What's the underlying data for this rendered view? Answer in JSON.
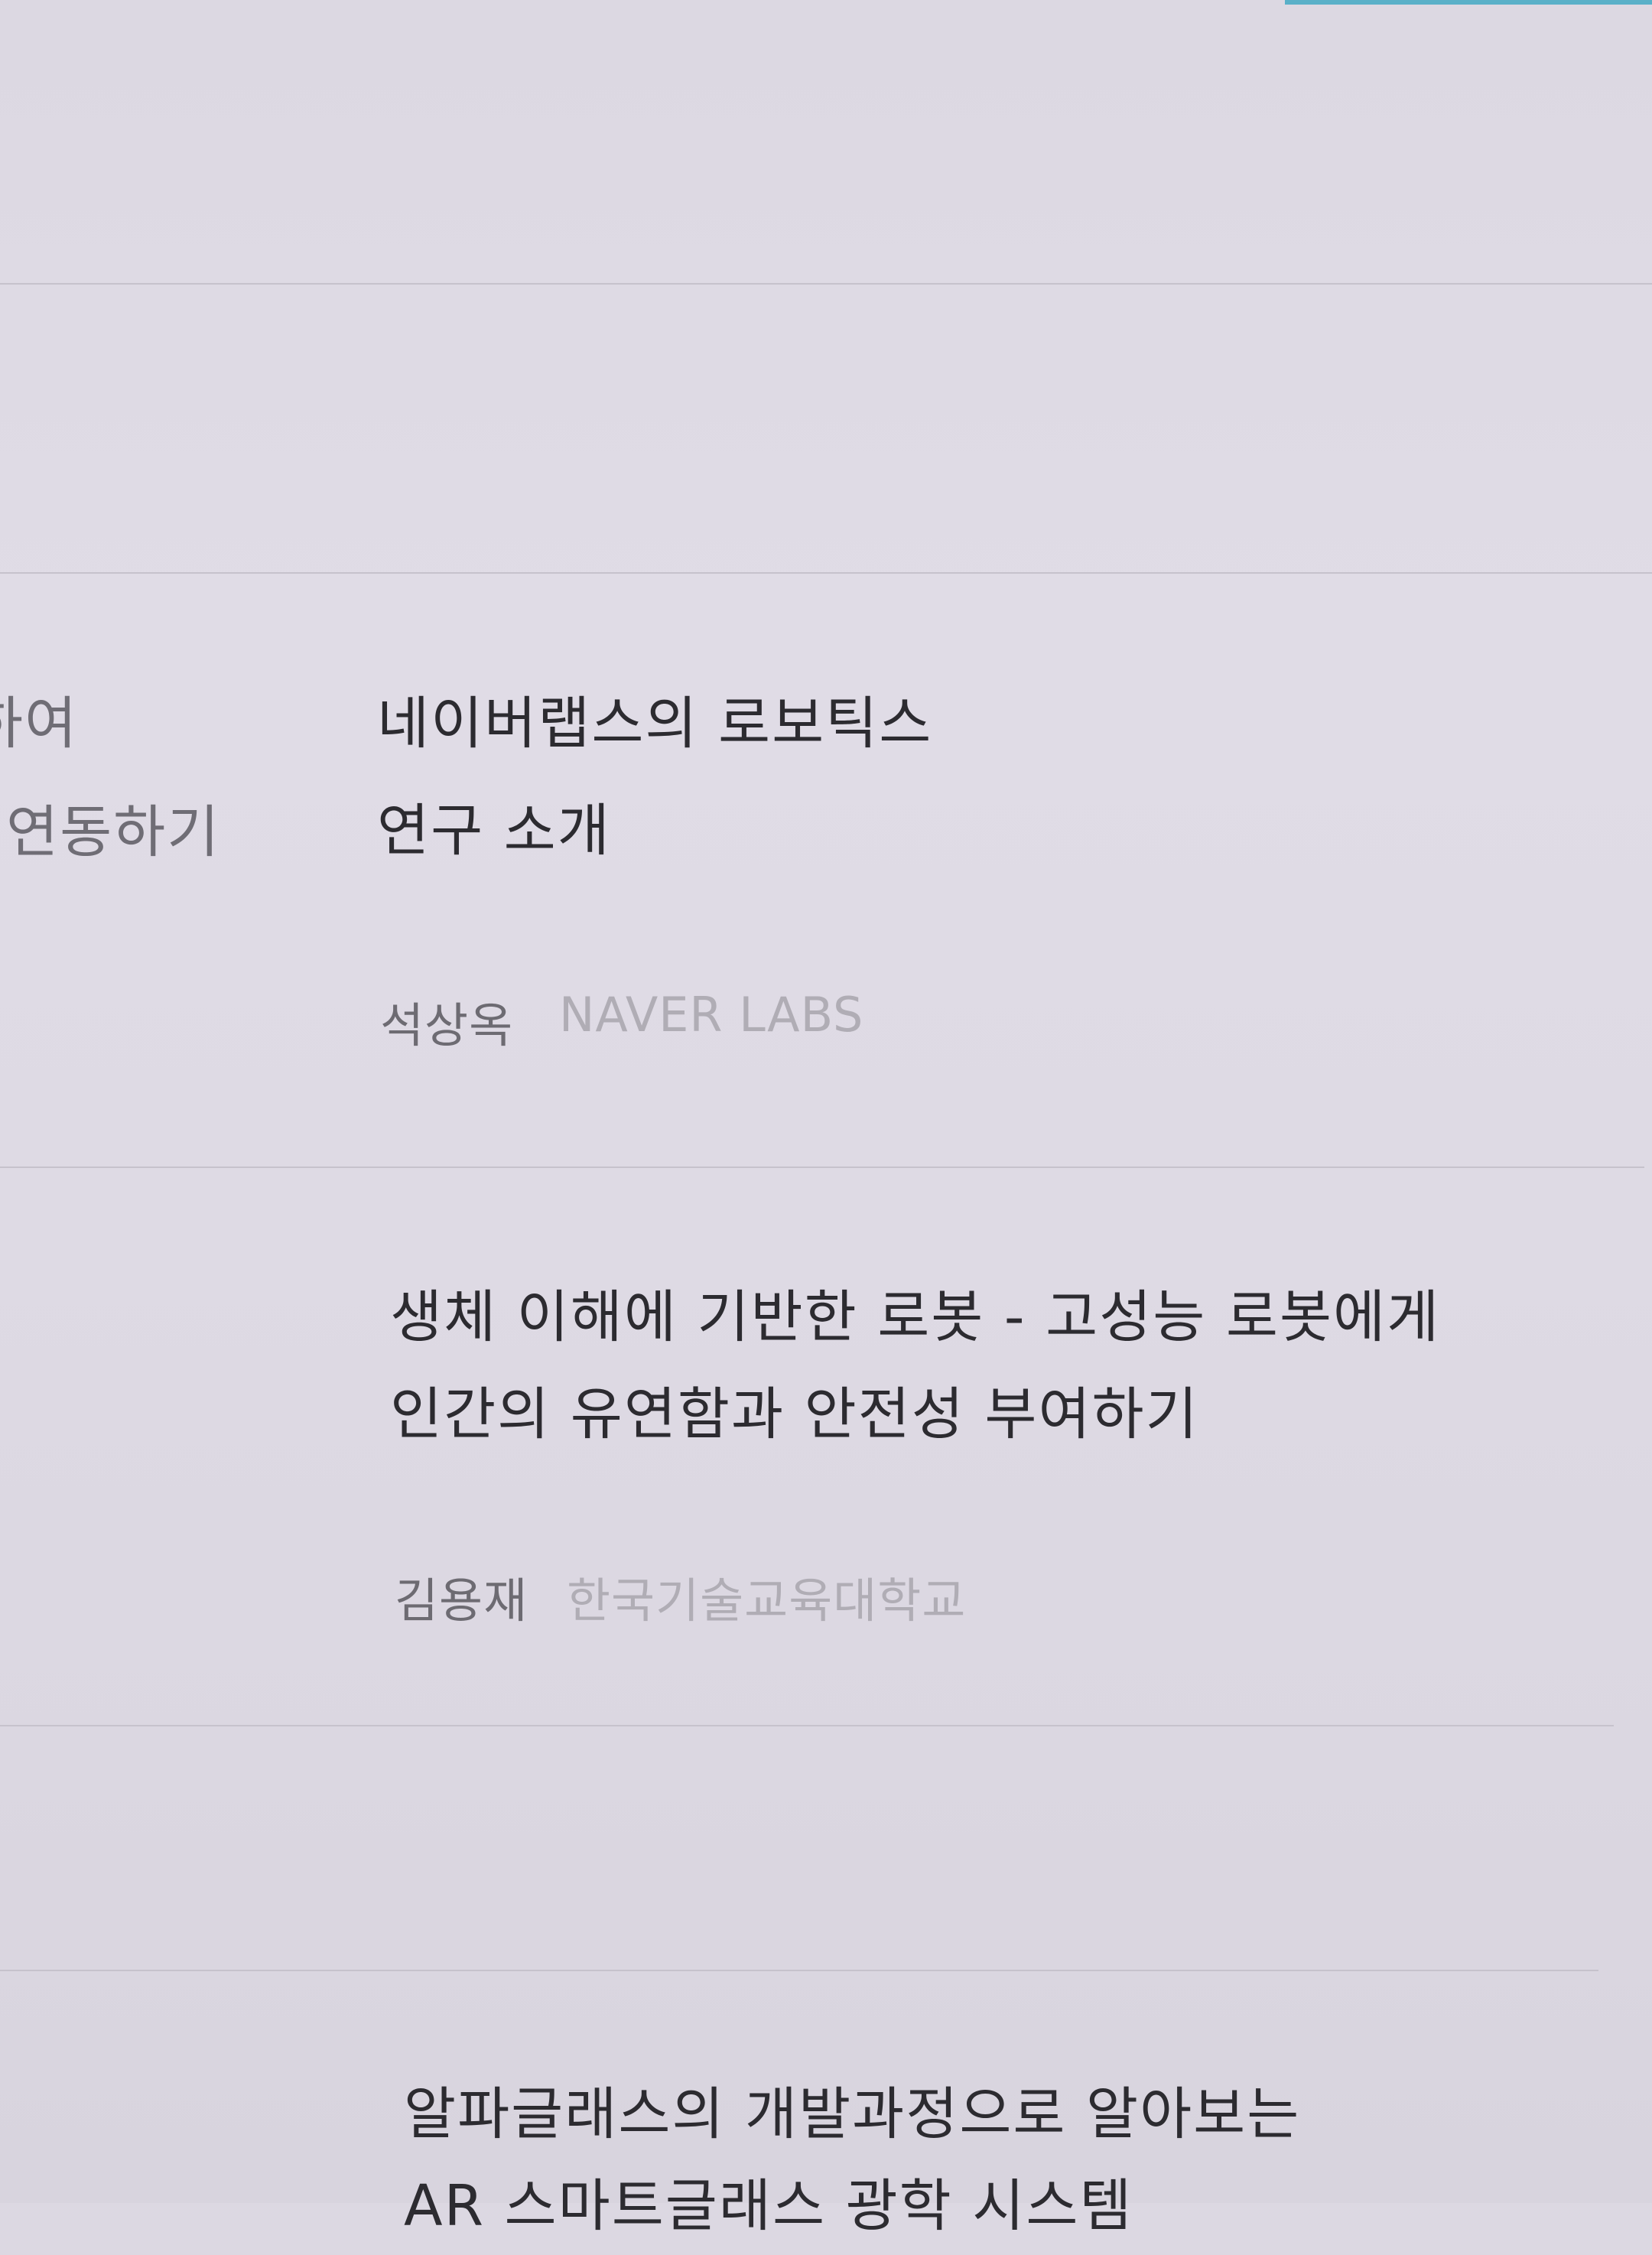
{
  "left_fragment": {
    "line1": "하여",
    "line2": "연동하기"
  },
  "sessions": [
    {
      "title_line1": "네이버랩스의 로보틱스",
      "title_line2": "연구 소개",
      "speaker": "석상옥",
      "affiliation": "NAVER LABS"
    },
    {
      "title_line1": "생체 이해에 기반한 로봇 - 고성능 로봇에게",
      "title_line2": "인간의 유연함과 안전성 부여하기",
      "speaker": "김용재",
      "affiliation": "한국기술교육대학교"
    },
    {
      "title_line1": "알파글래스의 개발과정으로 알아보는",
      "title_line2": "AR 스마트글래스 광학 시스템"
    }
  ],
  "colors": {
    "paper": "#dcd8e2",
    "title_text": "#2c2b30",
    "speaker_text": "#6d6b72",
    "affiliation_text": "#b0adb5",
    "accent": "#5ab0c8"
  }
}
